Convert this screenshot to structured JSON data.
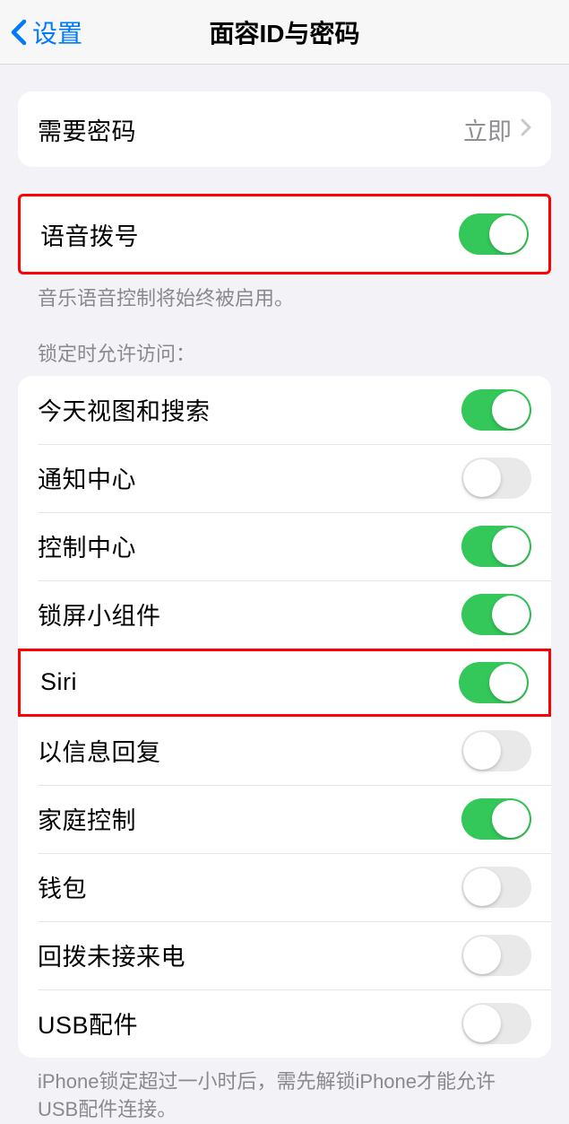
{
  "nav": {
    "back_label": "设置",
    "title": "面容ID与密码"
  },
  "require_passcode": {
    "label": "需要密码",
    "value": "立即"
  },
  "voice_dial": {
    "label": "语音拨号",
    "footer": "音乐语音控制将始终被启用。"
  },
  "lock_access": {
    "header": "锁定时允许访问：",
    "items": [
      {
        "label": "今天视图和搜索",
        "on": true
      },
      {
        "label": "通知中心",
        "on": false
      },
      {
        "label": "控制中心",
        "on": true
      },
      {
        "label": "锁屏小组件",
        "on": true
      },
      {
        "label": "Siri",
        "on": true,
        "highlighted": true
      },
      {
        "label": "以信息回复",
        "on": false
      },
      {
        "label": "家庭控制",
        "on": true
      },
      {
        "label": "钱包",
        "on": false
      },
      {
        "label": "回拨未接来电",
        "on": false
      },
      {
        "label": "USB配件",
        "on": false
      }
    ],
    "footer": "iPhone锁定超过一小时后，需先解锁iPhone才能允许USB配件连接。"
  }
}
